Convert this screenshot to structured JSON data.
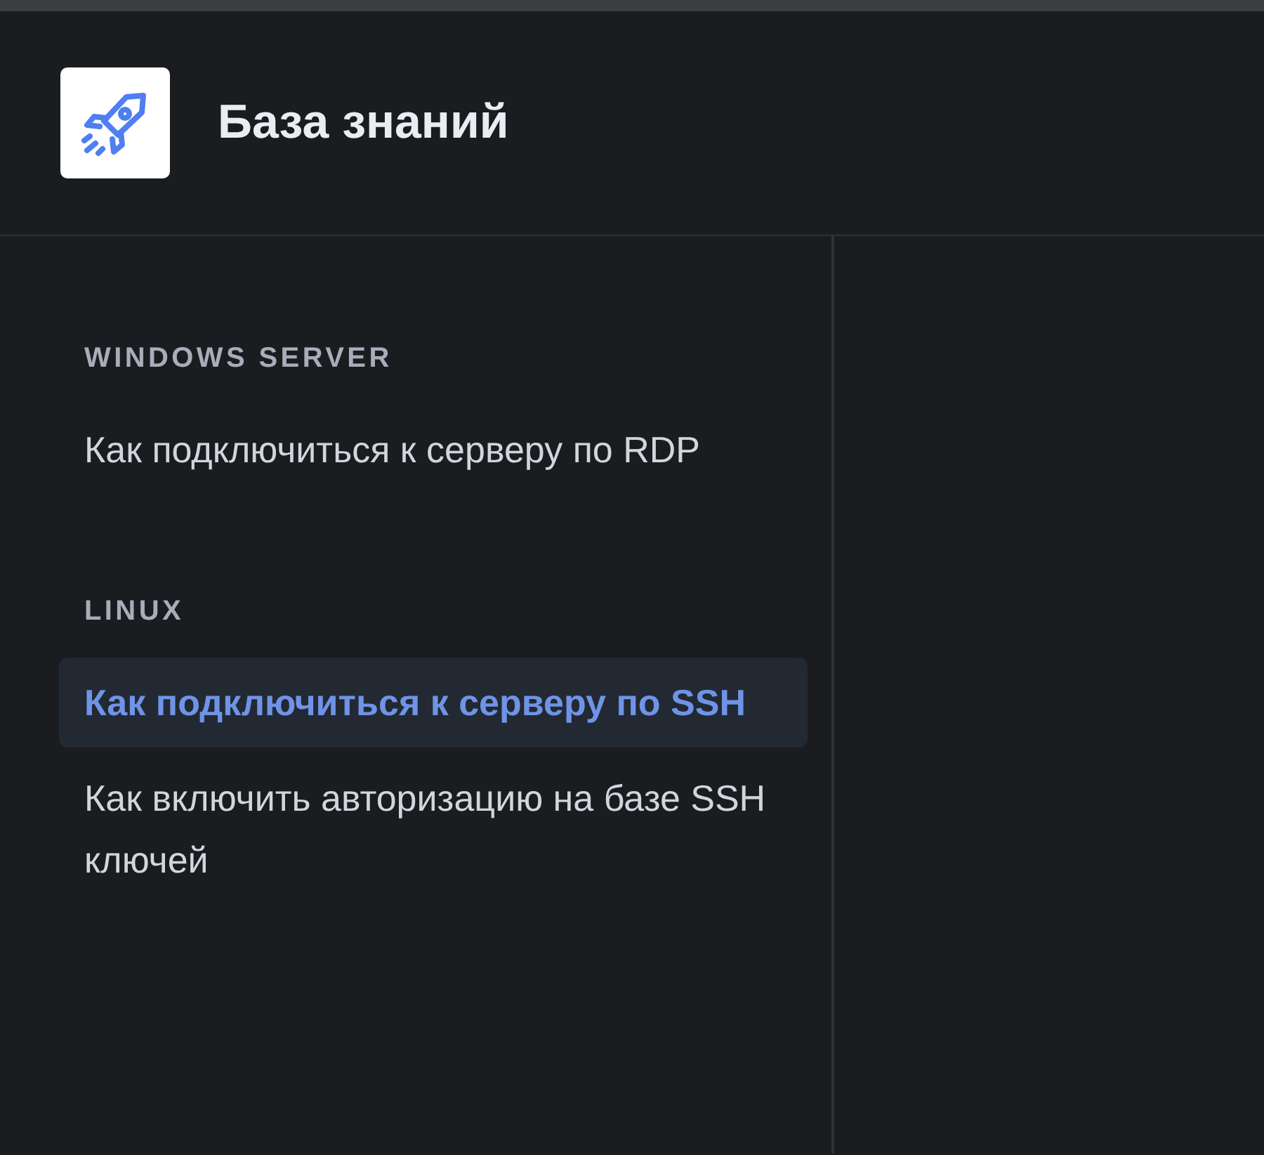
{
  "header": {
    "title": "База знаний"
  },
  "sidebar": {
    "sections": [
      {
        "heading": "WINDOWS SERVER",
        "items": [
          {
            "label": "Как подключиться к серверу по RDP",
            "selected": false
          }
        ]
      },
      {
        "heading": "LINUX",
        "items": [
          {
            "label": "Как подключиться к серверу по SSH",
            "selected": true
          },
          {
            "label": "Как включить авторизацию на базе SSH ключей",
            "selected": false
          }
        ]
      }
    ]
  }
}
